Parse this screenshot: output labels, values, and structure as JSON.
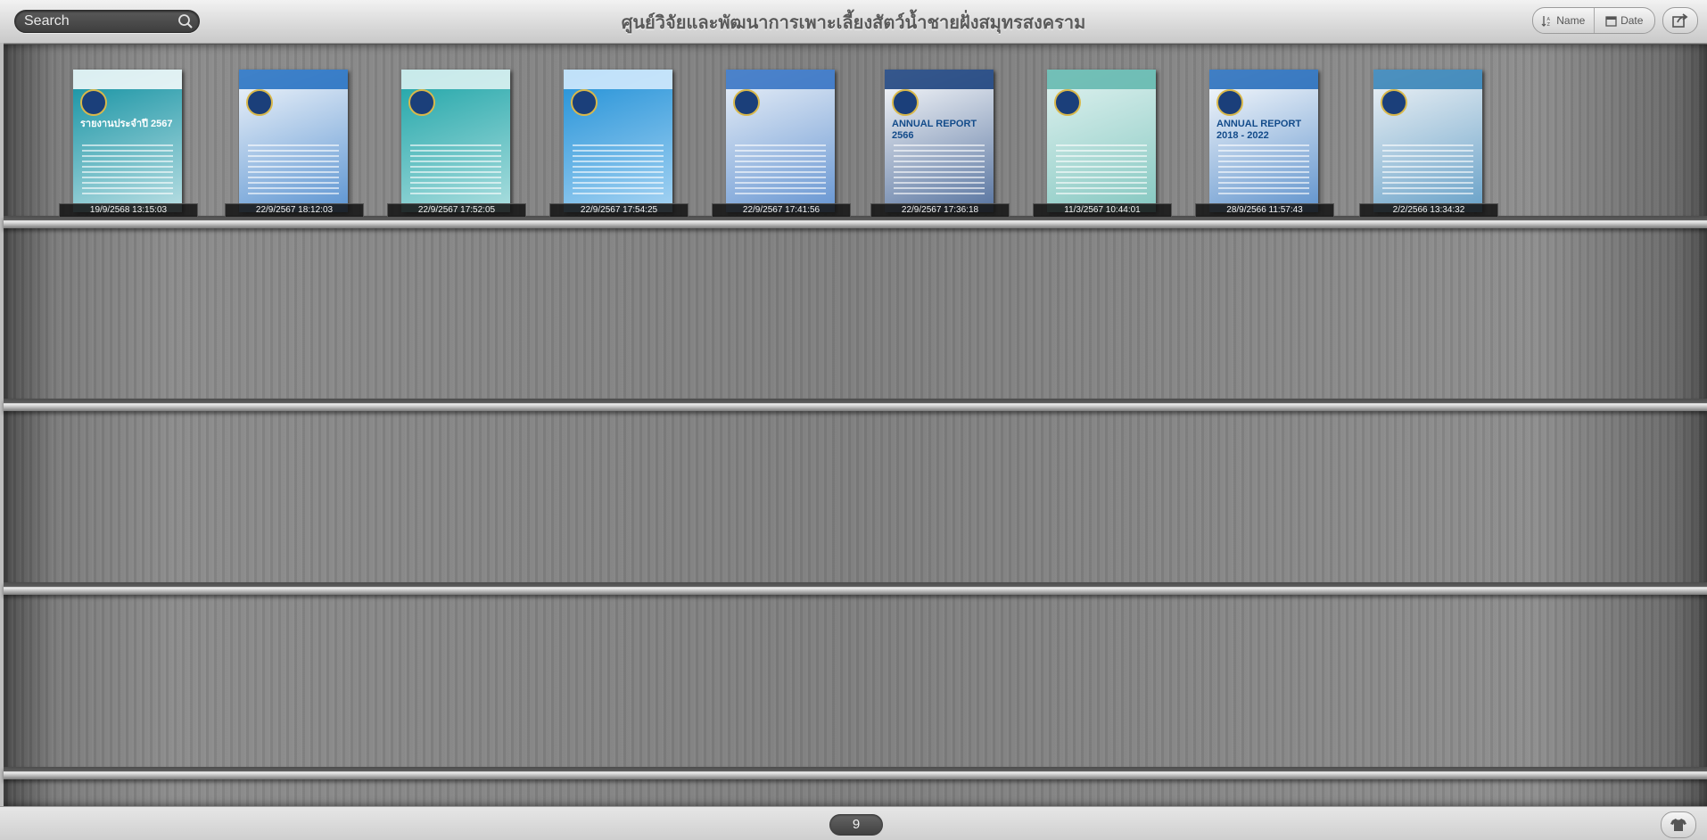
{
  "header": {
    "title": "ศูนย์วิจัยและพัฒนาการเพาะเลี้ยงสัตว์น้ำชายฝั่งสมุทรสงคราม",
    "search_placeholder": "Search",
    "sort_name_label": "Name",
    "sort_date_label": "Date"
  },
  "books": [
    {
      "date": "19/9/2568 13:15:03",
      "cover_text": "รายงานประจำปี 2567",
      "cover_color": "#0d8fa0",
      "accent": "#ffffff"
    },
    {
      "date": "22/9/2567 18:12:03",
      "cover_text": "",
      "cover_color": "#f5f8fc",
      "accent": "#1e6cc0"
    },
    {
      "date": "22/9/2567 17:52:05",
      "cover_text": "",
      "cover_color": "#1aa3a6",
      "accent": "#e6f6f6"
    },
    {
      "date": "22/9/2567 17:54:25",
      "cover_text": "",
      "cover_color": "#1e8fd6",
      "accent": "#dcefff"
    },
    {
      "date": "22/9/2567 17:41:56",
      "cover_text": "",
      "cover_color": "#eef3f9",
      "accent": "#2f6fc2"
    },
    {
      "date": "22/9/2567 17:36:18",
      "cover_text": "ANNUAL REPORT 2566",
      "cover_color": "#ffffff",
      "accent": "#123a78"
    },
    {
      "date": "11/3/2567 10:44:01",
      "cover_text": "",
      "cover_color": "#e2f3f1",
      "accent": "#5fb6ad"
    },
    {
      "date": "28/9/2566 11:57:43",
      "cover_text": "ANNUAL REPORT 2018 - 2022",
      "cover_color": "#ffffff",
      "accent": "#1f67b8"
    },
    {
      "date": "2/2/2566 13:34:32",
      "cover_text": "",
      "cover_color": "#f3f5f7",
      "accent": "#2f7fb5"
    }
  ],
  "footer": {
    "page_count": "9"
  }
}
